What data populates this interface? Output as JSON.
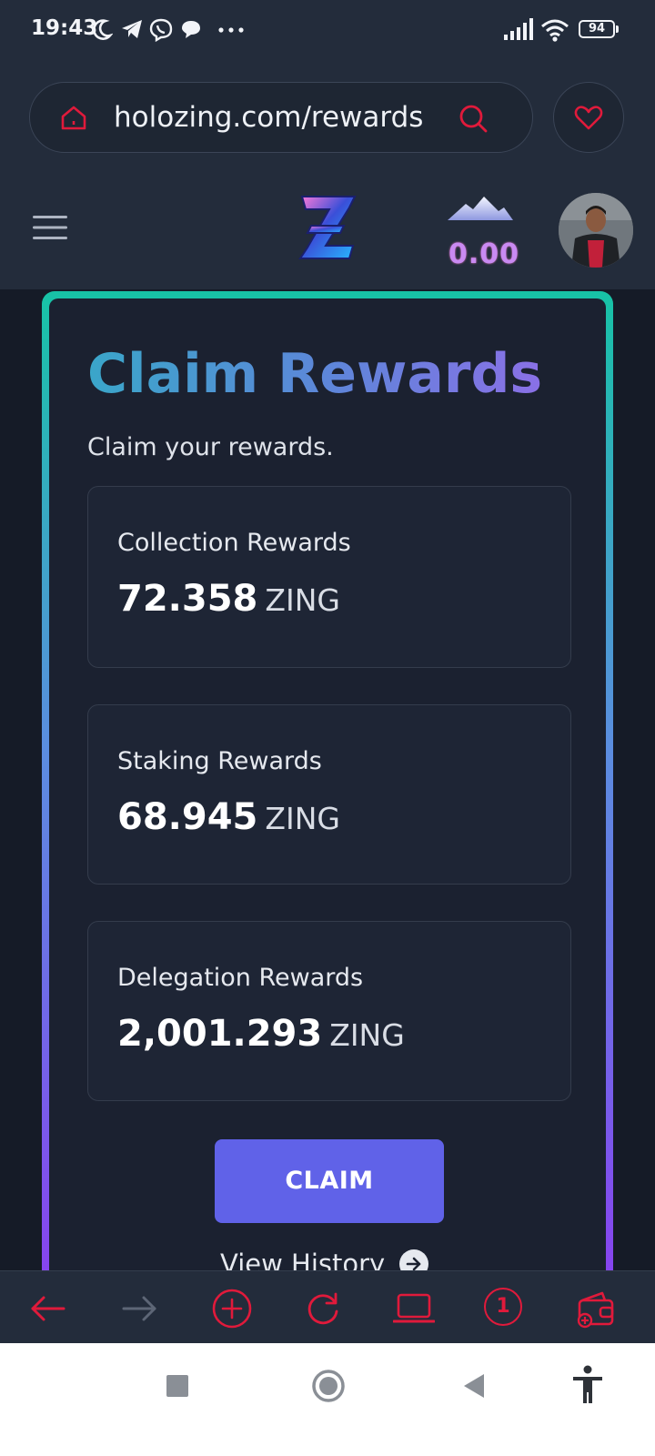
{
  "status_bar": {
    "time": "19:43",
    "battery": "94",
    "icons": [
      "moon-icon",
      "telegram-icon",
      "viber-icon",
      "chat-bubble-icon",
      "more-dots-icon",
      "signal-icon",
      "wifi-icon",
      "battery-icon"
    ]
  },
  "browser": {
    "url": "holozing.com/rewards",
    "icons": [
      "home-icon",
      "search-icon",
      "heart-icon"
    ]
  },
  "header": {
    "balance": "0.00",
    "icons": [
      "hamburger-menu-icon",
      "holozing-logo",
      "mountain-icon"
    ]
  },
  "claim": {
    "title": "Claim Rewards",
    "subtitle": "Claim your rewards.",
    "rewards": [
      {
        "label": "Collection Rewards",
        "value": "72.358",
        "unit": "ZING"
      },
      {
        "label": "Staking Rewards",
        "value": "68.945",
        "unit": "ZING"
      },
      {
        "label": "Delegation Rewards",
        "value": "2,001.293",
        "unit": "ZING"
      }
    ],
    "claim_label": "CLAIM",
    "history_label": "View History"
  },
  "toolbar": {
    "tab_count": "1",
    "icons": [
      "back-arrow-icon",
      "forward-arrow-icon",
      "new-tab-icon",
      "reload-icon",
      "desktop-mode-icon",
      "tabs-icon",
      "wallet-icon"
    ]
  },
  "nav_bar": {
    "icons": [
      "recents-square-icon",
      "home-circle-icon",
      "back-triangle-icon",
      "accessibility-icon"
    ]
  },
  "colors": {
    "accent_red": "#e01a3b",
    "claim_button": "#6062e8",
    "balance_purple": "#c98af2"
  }
}
